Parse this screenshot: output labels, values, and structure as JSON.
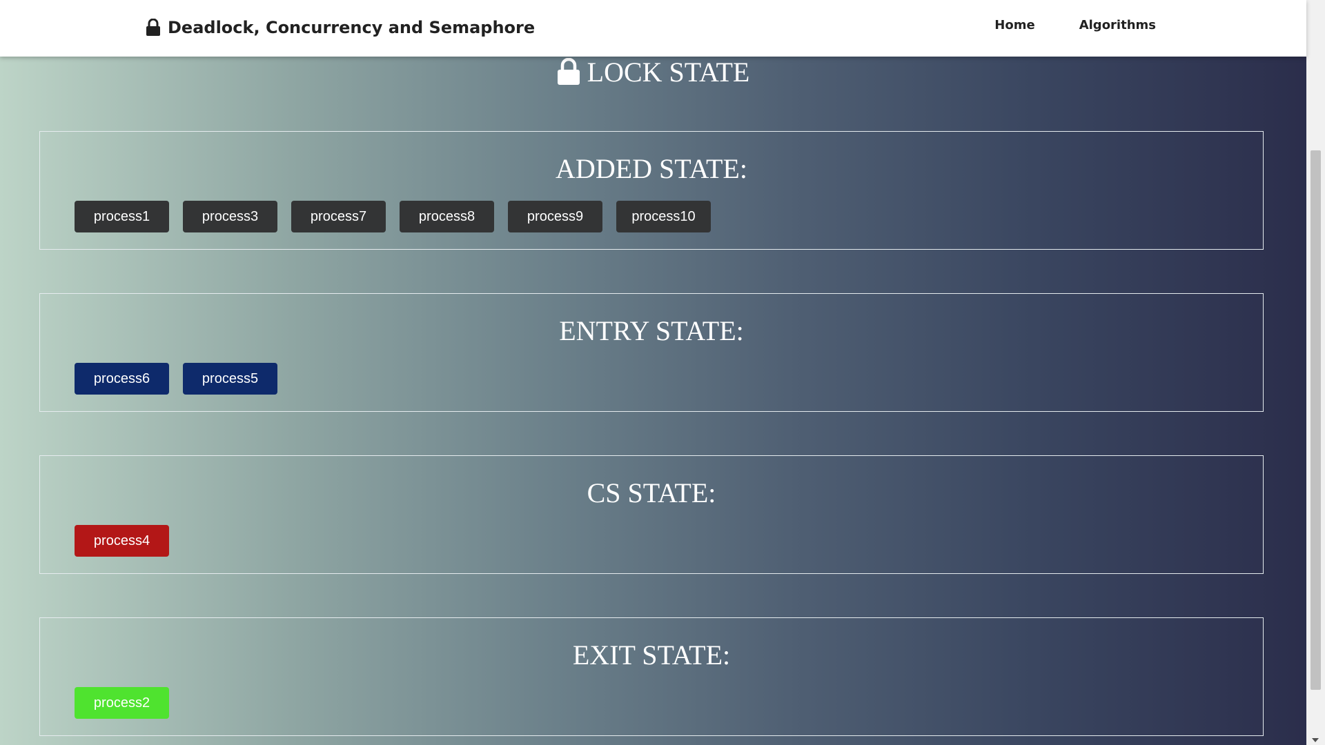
{
  "navbar": {
    "brand_icon": "lock-icon",
    "brand": "Deadlock, Concurrency and Semaphore",
    "links": [
      "Home",
      "Algorithms"
    ]
  },
  "heading": {
    "icon": "lock-icon",
    "title": "LOCK STATE"
  },
  "states": {
    "added": {
      "title": "ADDED STATE:",
      "color": "#333435",
      "processes": [
        "process1",
        "process3",
        "process7",
        "process8",
        "process9",
        "process10"
      ]
    },
    "entry": {
      "title": "ENTRY STATE:",
      "color": "#0e2a6b",
      "processes": [
        "process6",
        "process5"
      ]
    },
    "cs": {
      "title": "CS STATE:",
      "color": "#b31717",
      "processes": [
        "process4"
      ]
    },
    "exit": {
      "title": "EXIT STATE:",
      "color": "#4fe32f",
      "processes": [
        "process2"
      ]
    }
  }
}
